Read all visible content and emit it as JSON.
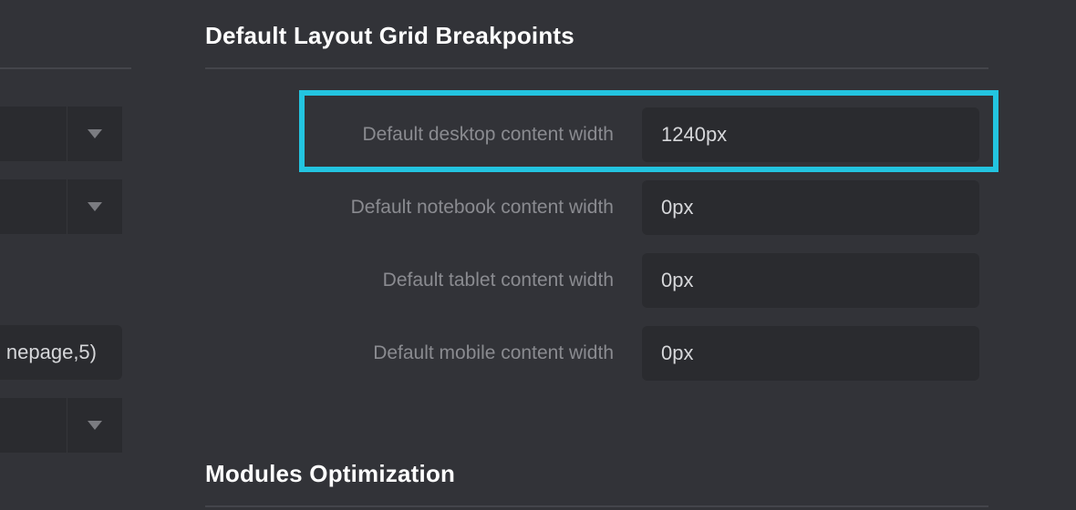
{
  "left_panel": {
    "select_1": {
      "value": "",
      "icon": "chevron-down-icon"
    },
    "select_2": {
      "value": "",
      "icon": "chevron-down-icon"
    },
    "text_field": {
      "value": "nepage,5)"
    },
    "select_3": {
      "value": "",
      "icon": "chevron-down-icon"
    }
  },
  "breakpoints_section": {
    "title": "Default Layout Grid Breakpoints",
    "fields": [
      {
        "label": "Default desktop content width",
        "value": "1240px",
        "highlighted": true
      },
      {
        "label": "Default notebook content width",
        "value": "0px",
        "highlighted": false
      },
      {
        "label": "Default tablet content width",
        "value": "0px",
        "highlighted": false
      },
      {
        "label": "Default mobile content width",
        "value": "0px",
        "highlighted": false
      }
    ]
  },
  "modules_section": {
    "title": "Modules Optimization"
  },
  "colors": {
    "background": "#323338",
    "input_background": "#2a2b2f",
    "highlight": "#23c4e0",
    "label_text": "#8a8b90",
    "value_text": "#d6d7da",
    "title_text": "#ffffff"
  }
}
